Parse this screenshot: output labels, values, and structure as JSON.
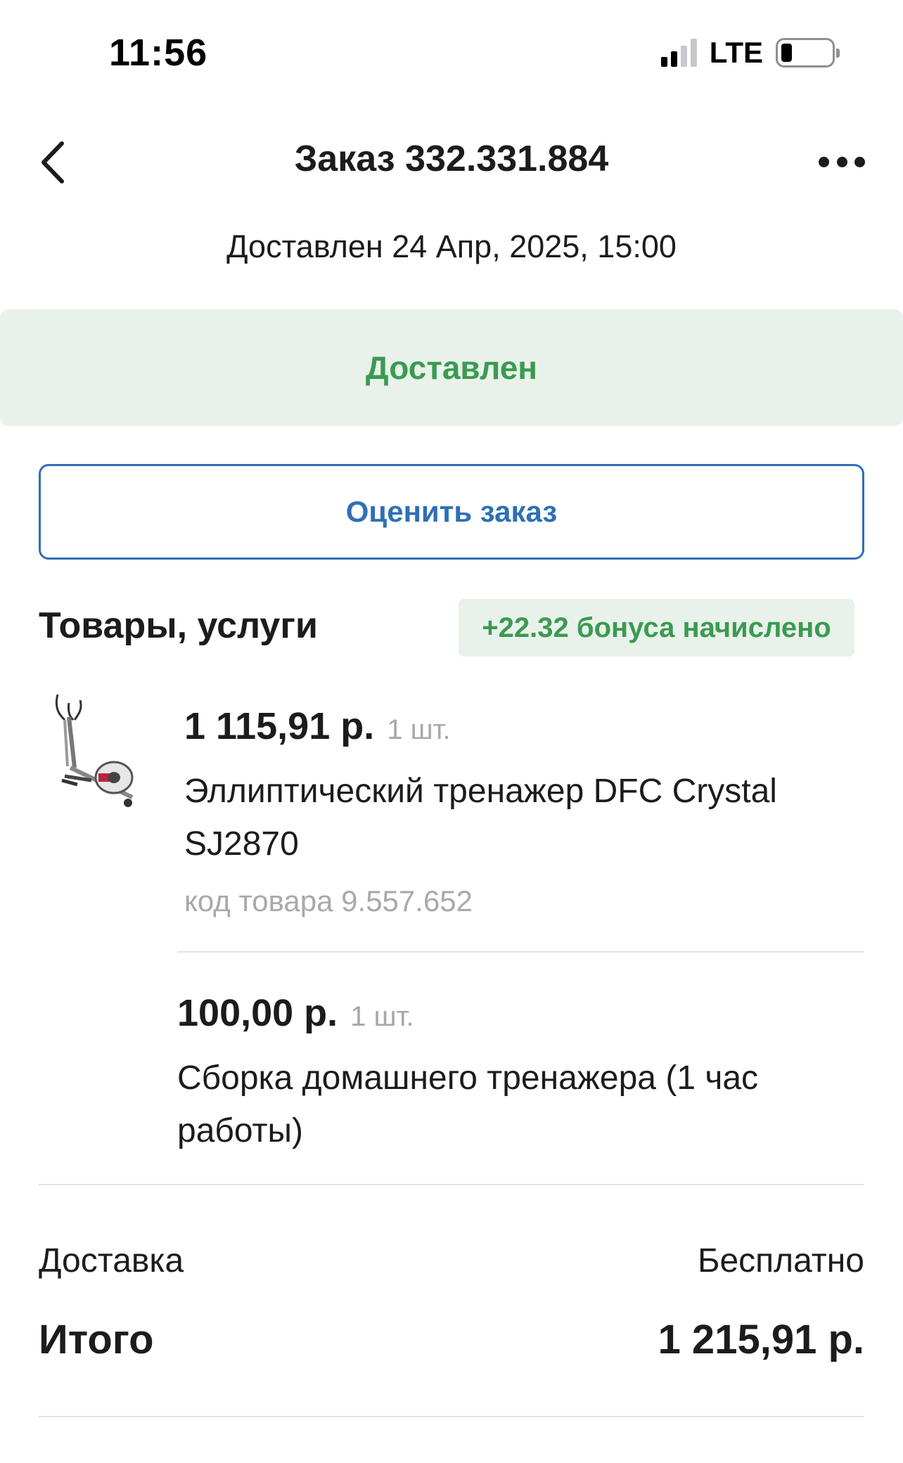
{
  "status_bar": {
    "time": "11:56",
    "network": "LTE",
    "signal_bars_active": 2,
    "signal_bars_total": 4,
    "battery_level_fraction": 0.2
  },
  "nav": {
    "title": "Заказ 332.331.884",
    "back_icon": "chevron-left-icon",
    "more_icon": "more-horizontal-icon"
  },
  "order": {
    "delivered_date": "Доставлен 24 Апр, 2025, 15:00",
    "status": "Доставлен",
    "rate_button": "Оценить заказ"
  },
  "items_section": {
    "title": "Товары, услуги",
    "bonus": "+22.32 бонуса начислено",
    "items": [
      {
        "price": "1 115,91 р.",
        "qty": "1 шт.",
        "name_line1": "Эллиптический тренажер DFC Crystal",
        "name_line2": "SJ2870",
        "code": "код товара 9.557.652",
        "image_icon": "elliptical-trainer-image"
      },
      {
        "price": "100,00 р.",
        "qty": "1 шт.",
        "name_line1": "Сборка домашнего тренажера (1 час",
        "name_line2": "работы)"
      }
    ]
  },
  "summary": {
    "delivery_label": "Доставка",
    "delivery_value": "Бесплатно",
    "total_label": "Итого",
    "total_value": "1 215,91 р."
  },
  "colors": {
    "accent_blue": "#2f6fb7",
    "status_green": "#3b9a52",
    "status_bg": "#e8f2ea",
    "muted_text": "#a8a8ad"
  }
}
